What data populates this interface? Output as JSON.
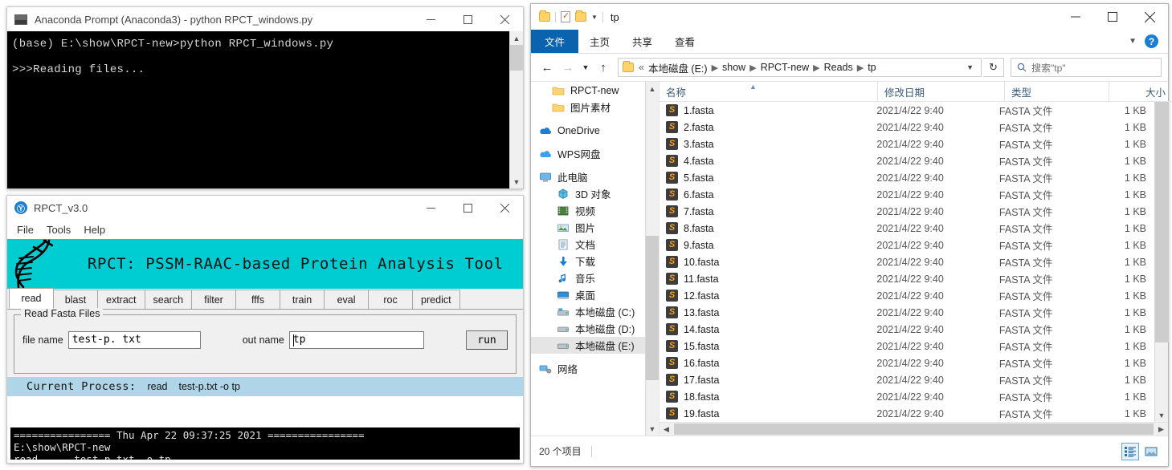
{
  "anaconda": {
    "title": "Anaconda Prompt (Anaconda3) - python  RPCT_windows.py",
    "icon": "console-icon",
    "console": "(base) E:\\show\\RPCT-new>python RPCT_windows.py\n\n>>>Reading files...",
    "minimize": "—",
    "maximize": "□",
    "close": "✕"
  },
  "rpct": {
    "title": "RPCT_v3.0",
    "icon_letter": "Ⓟ",
    "menu": [
      "File",
      "Tools",
      "Help"
    ],
    "banner_title": "RPCT: PSSM-RAAC-based Protein Analysis Tool",
    "banner_color": "#00cdd2",
    "tabs": [
      "read",
      "blast",
      "extract",
      "search",
      "filter",
      "fffs",
      "train",
      "eval",
      "roc",
      "predict"
    ],
    "active_tab": "read",
    "group_legend": "Read Fasta Files",
    "file_name_label": "file name",
    "file_name_value": "test-p. txt",
    "out_name_label": "out name",
    "out_name_value": "tp",
    "run_label": "run",
    "process_label": "Current Process:",
    "process_cmd": "read",
    "process_args": "test-p.txt -o tp",
    "process_bar_color": "#aed6e8",
    "console": "================ Thu Apr 22 09:37:25 2021 ================\nE:\\show\\RPCT-new\nread      test-p.txt -o tp",
    "minimize": "—",
    "maximize": "□",
    "close": "✕"
  },
  "explorer": {
    "title": "tp",
    "quick_access": [
      "folder-icon",
      "properties-icon",
      "new-folder-icon",
      "customize-caret-icon"
    ],
    "ribbon_tabs": [
      "文件",
      "主页",
      "共享",
      "查看"
    ],
    "ribbon_active": "文件",
    "help_label": "?",
    "breadcrumbs": [
      "本地磁盘 (E:)",
      "show",
      "RPCT-new",
      "Reads",
      "tp"
    ],
    "breadcrumb_prefix": "«",
    "search_placeholder": "搜索\"tp\"",
    "minimize": "—",
    "maximize": "□",
    "close": "✕",
    "nav_items": [
      {
        "label": "RPCT-new",
        "icon": "folder-icon",
        "indent": 1,
        "selected": false
      },
      {
        "label": "图片素材",
        "icon": "folder-icon",
        "indent": 1,
        "selected": false
      },
      {
        "label": "",
        "icon": "gap",
        "indent": 0,
        "selected": false
      },
      {
        "label": "OneDrive",
        "icon": "onedrive-icon",
        "indent": 0,
        "selected": false
      },
      {
        "label": "",
        "icon": "gap",
        "indent": 0,
        "selected": false
      },
      {
        "label": "WPS网盘",
        "icon": "wps-cloud-icon",
        "indent": 0,
        "selected": false
      },
      {
        "label": "",
        "icon": "gap",
        "indent": 0,
        "selected": false
      },
      {
        "label": "此电脑",
        "icon": "this-pc-icon",
        "indent": 0,
        "selected": false
      },
      {
        "label": "3D 对象",
        "icon": "3d-objects-icon",
        "indent": 1,
        "selected": false
      },
      {
        "label": "视频",
        "icon": "videos-icon",
        "indent": 1,
        "selected": false
      },
      {
        "label": "图片",
        "icon": "pictures-icon",
        "indent": 1,
        "selected": false
      },
      {
        "label": "文档",
        "icon": "documents-icon",
        "indent": 1,
        "selected": false
      },
      {
        "label": "下载",
        "icon": "downloads-icon",
        "indent": 1,
        "selected": false
      },
      {
        "label": "音乐",
        "icon": "music-icon",
        "indent": 1,
        "selected": false
      },
      {
        "label": "桌面",
        "icon": "desktop-icon",
        "indent": 1,
        "selected": false
      },
      {
        "label": "本地磁盘 (C:)",
        "icon": "system-drive-icon",
        "indent": 1,
        "selected": false
      },
      {
        "label": "本地磁盘 (D:)",
        "icon": "drive-icon",
        "indent": 1,
        "selected": false
      },
      {
        "label": "本地磁盘 (E:)",
        "icon": "drive-icon",
        "indent": 1,
        "selected": true
      },
      {
        "label": "",
        "icon": "gap",
        "indent": 0,
        "selected": false
      },
      {
        "label": "网络",
        "icon": "network-icon",
        "indent": 0,
        "selected": false
      }
    ],
    "columns": [
      "名称",
      "修改日期",
      "类型",
      "大小"
    ],
    "sort_column": "名称",
    "files": [
      {
        "name": "1.fasta",
        "date": "2021/4/22 9:40",
        "type": "FASTA 文件",
        "size": "1 KB"
      },
      {
        "name": "2.fasta",
        "date": "2021/4/22 9:40",
        "type": "FASTA 文件",
        "size": "1 KB"
      },
      {
        "name": "3.fasta",
        "date": "2021/4/22 9:40",
        "type": "FASTA 文件",
        "size": "1 KB"
      },
      {
        "name": "4.fasta",
        "date": "2021/4/22 9:40",
        "type": "FASTA 文件",
        "size": "1 KB"
      },
      {
        "name": "5.fasta",
        "date": "2021/4/22 9:40",
        "type": "FASTA 文件",
        "size": "1 KB"
      },
      {
        "name": "6.fasta",
        "date": "2021/4/22 9:40",
        "type": "FASTA 文件",
        "size": "1 KB"
      },
      {
        "name": "7.fasta",
        "date": "2021/4/22 9:40",
        "type": "FASTA 文件",
        "size": "1 KB"
      },
      {
        "name": "8.fasta",
        "date": "2021/4/22 9:40",
        "type": "FASTA 文件",
        "size": "1 KB"
      },
      {
        "name": "9.fasta",
        "date": "2021/4/22 9:40",
        "type": "FASTA 文件",
        "size": "1 KB"
      },
      {
        "name": "10.fasta",
        "date": "2021/4/22 9:40",
        "type": "FASTA 文件",
        "size": "1 KB"
      },
      {
        "name": "11.fasta",
        "date": "2021/4/22 9:40",
        "type": "FASTA 文件",
        "size": "1 KB"
      },
      {
        "name": "12.fasta",
        "date": "2021/4/22 9:40",
        "type": "FASTA 文件",
        "size": "1 KB"
      },
      {
        "name": "13.fasta",
        "date": "2021/4/22 9:40",
        "type": "FASTA 文件",
        "size": "1 KB"
      },
      {
        "name": "14.fasta",
        "date": "2021/4/22 9:40",
        "type": "FASTA 文件",
        "size": "1 KB"
      },
      {
        "name": "15.fasta",
        "date": "2021/4/22 9:40",
        "type": "FASTA 文件",
        "size": "1 KB"
      },
      {
        "name": "16.fasta",
        "date": "2021/4/22 9:40",
        "type": "FASTA 文件",
        "size": "1 KB"
      },
      {
        "name": "17.fasta",
        "date": "2021/4/22 9:40",
        "type": "FASTA 文件",
        "size": "1 KB"
      },
      {
        "name": "18.fasta",
        "date": "2021/4/22 9:40",
        "type": "FASTA 文件",
        "size": "1 KB"
      },
      {
        "name": "19.fasta",
        "date": "2021/4/22 9:40",
        "type": "FASTA 文件",
        "size": "1 KB"
      }
    ],
    "status_text": "20 个项目",
    "view_buttons": [
      "details-view-icon",
      "large-icons-view-icon"
    ],
    "active_view": "details-view-icon"
  }
}
